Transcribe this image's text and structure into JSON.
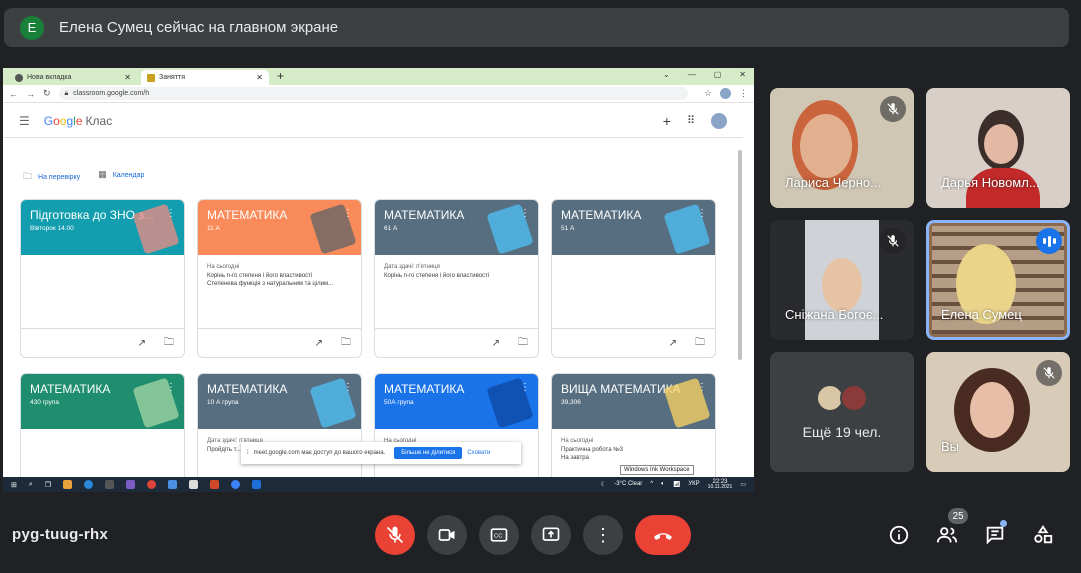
{
  "banner": {
    "avatar_letter": "E",
    "text": "Елена Сумец сейчас на главном экране"
  },
  "shared_screen": {
    "tabs": [
      {
        "label": "Нова вкладка"
      },
      {
        "label": "Заняття"
      }
    ],
    "url": "classroom.google.com/h",
    "app_name_parts": [
      "G",
      "o",
      "o",
      "g",
      "l",
      "e"
    ],
    "app_suffix": "Клас",
    "subnav": [
      {
        "label": "На перевірку"
      },
      {
        "label": "Календар"
      }
    ],
    "cards": [
      {
        "title": "Підготовка до ЗНО з...",
        "sub": "Вівторок 14.00",
        "color": "#129eaf",
        "deco": "#f28b82",
        "body_label": "",
        "body": []
      },
      {
        "title": "МАТЕМАТИКА",
        "sub": "11 А",
        "color": "#f98b5a",
        "deco": "#5f6368",
        "body_label": "На сьогодні",
        "body": [
          "Корінь n-го степеня і його властивості",
          "Степенева функція з натуральним та цілим..."
        ]
      },
      {
        "title": "МАТЕМАТИКА",
        "sub": "61 А",
        "color": "#566e7f",
        "deco": "#4fc3f7",
        "body_label": "Дата здачі: п'ятниця",
        "body": [
          "Корінь n-го степеня і його властивості"
        ]
      },
      {
        "title": "МАТЕМАТИКА",
        "sub": "51 А",
        "color": "#566e7f",
        "deco": "#4fc3f7",
        "body_label": "",
        "body": []
      },
      {
        "title": "МАТЕМАТИКА",
        "sub": "430 група",
        "color": "#1e8e6e",
        "deco": "#a5d6a7",
        "body_label": "",
        "body": []
      },
      {
        "title": "МАТЕМАТИКА",
        "sub": "10 А група",
        "color": "#566e7f",
        "deco": "#4fc3f7",
        "body_label": "Дата здачі: п'ятниця",
        "body": [
          "Пройдіть т..."
        ]
      },
      {
        "title": "МАТЕМАТИКА",
        "sub": "50А група",
        "color": "#1a73e8",
        "deco": "#0d47a1",
        "body_label": "На сьогодні",
        "body": []
      },
      {
        "title": "ВИЩА МАТЕМАТИКА",
        "sub": "39,306",
        "color": "#566e7f",
        "deco": "#fdd663",
        "body_label": "На сьогодні",
        "body": [
          "Практична робота №3",
          "",
          "На завтра"
        ]
      }
    ],
    "notice": {
      "text": "meet.google.com має доступ до вашого екрана.",
      "stop": "Більше не ділитися",
      "hide": "Сховати"
    },
    "ink_tooltip": "Windows Ink Workspace",
    "tray": {
      "weather": "-3°C  Clear",
      "lang": "УКР",
      "time": "22:23",
      "date": "10.11.2021"
    }
  },
  "participants": [
    {
      "name": "Лариса Черно...",
      "muted": true
    },
    {
      "name": "Дарья Новомл...",
      "muted": false
    },
    {
      "name": "Сніжана Богоє...",
      "muted": true
    },
    {
      "name": "Елена Сумец",
      "muted": false,
      "speaking": true
    },
    {
      "name": "Ещё 19 чел.",
      "muted": false
    },
    {
      "name": "Вы",
      "muted": true
    }
  ],
  "meeting": {
    "code": "pyg-tuug-rhx",
    "participant_count": "25"
  },
  "colors": {
    "background": "#202124",
    "tile": "#3c4043",
    "danger": "#ea4335",
    "accent": "#1a73e8"
  }
}
